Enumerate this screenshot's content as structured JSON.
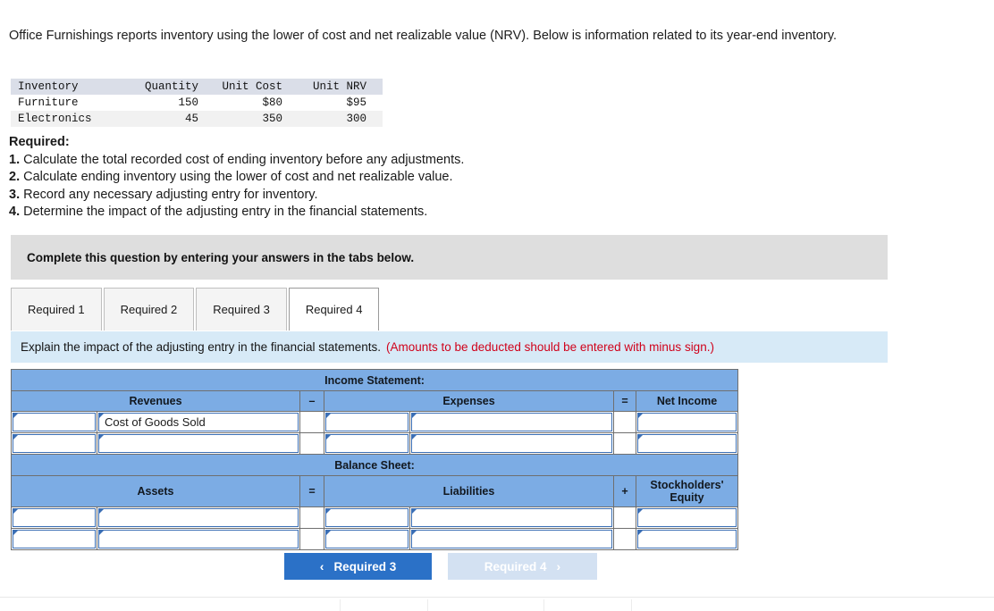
{
  "stem": {
    "text": "Office Furnishings reports inventory using the lower of cost and net realizable value (NRV). Below is information related to its year-end inventory."
  },
  "inventory_table": {
    "headers": [
      "Inventory",
      "Quantity",
      "Unit Cost",
      "Unit NRV"
    ],
    "rows": [
      [
        "Furniture",
        "150",
        "$80",
        "$95"
      ],
      [
        "Electronics",
        "45",
        "350",
        "300"
      ]
    ]
  },
  "required": {
    "heading": "Required:",
    "items": [
      {
        "num": "1.",
        "text": "Calculate the total recorded cost of ending inventory before any adjustments."
      },
      {
        "num": "2.",
        "text": "Calculate ending inventory using the lower of cost and net realizable value."
      },
      {
        "num": "3.",
        "text": "Record any necessary adjusting entry for inventory."
      },
      {
        "num": "4.",
        "text": "Determine the impact of the adjusting entry in the financial statements."
      }
    ]
  },
  "banner": {
    "text": "Complete this question by entering your answers in the tabs below."
  },
  "tabs": {
    "items": [
      {
        "label": "Required 1",
        "active": false
      },
      {
        "label": "Required 2",
        "active": false
      },
      {
        "label": "Required 3",
        "active": false
      },
      {
        "label": "Required 4",
        "active": true
      }
    ]
  },
  "prompt": {
    "main": "Explain the impact of the adjusting entry in the financial statements.",
    "note": "(Amounts to be deducted should be entered with minus sign.)",
    "note_color": "#d0021b"
  },
  "worksheet": {
    "income_statement": {
      "title": "Income Statement:",
      "columns": {
        "revenues": "Revenues",
        "operator_1": "–",
        "expenses": "Expenses",
        "operator_2": "=",
        "net_income": "Net Income"
      },
      "rows": [
        {
          "revenue_account": "",
          "revenue_amount": "Cost of Goods Sold",
          "op1": "",
          "expense_account": "",
          "expense_amount": "",
          "op2": "",
          "net_income": ""
        },
        {
          "revenue_account": "",
          "revenue_amount": "",
          "op1": "",
          "expense_account": "",
          "expense_amount": "",
          "op2": "",
          "net_income": ""
        }
      ]
    },
    "balance_sheet": {
      "title": "Balance Sheet:",
      "columns": {
        "assets": "Assets",
        "operator_1": "=",
        "liabilities": "Liabilities",
        "operator_2": "+",
        "equity": "Stockholders' Equity"
      },
      "rows": [
        {
          "asset_account": "",
          "asset_amount": "",
          "op1": "",
          "liability_account": "",
          "liability_amount": "",
          "op2": "",
          "equity": ""
        },
        {
          "asset_account": "",
          "asset_amount": "",
          "op1": "",
          "liability_account": "",
          "liability_amount": "",
          "op2": "",
          "equity": ""
        }
      ]
    }
  },
  "nav": {
    "prev_label": "Required 3",
    "next_label": "Required 4",
    "prev_chevron": "‹",
    "next_chevron": "›",
    "prev_color": "#2b71c7",
    "next_color": "#d3e1f2"
  },
  "theme": {
    "header_blue": "#7cace4",
    "input_border_blue": "#3b6fb5",
    "banner_grey": "#dedede",
    "prompt_blue": "#d7eaf7"
  }
}
